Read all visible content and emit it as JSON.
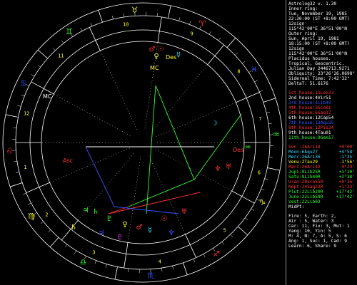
{
  "app": {
    "title": "Astrolog32 v. 1.30"
  },
  "chart_info": [
    "Inner ring:",
    "Tue, November 19, 1985",
    "22:30:00 (ST +8:00 GMT)",
    "12sign",
    "115°42'00\"E 36°51'00\"N",
    "Outer ring:",
    "Sun, April 19, 1981",
    "18:15:00 (ST +8:00 GMT)",
    "12sign",
    "115°42'00\"E 36°51'00\"N",
    "Placidus houses.",
    "Tropical, Geocentric.",
    "Julian Day 2446713.9271",
    "Obliquity: 23°26'26.0698\"",
    "Sidereal Time: 7:42'32\"",
    "DeltaT: 51.6176"
  ],
  "houses": [
    {
      "label": "1st house:",
      "value": "11Leo33",
      "color": "#ff3333"
    },
    {
      "label": "2nd house:",
      "value": "4Vir51",
      "color": "#ffffff"
    },
    {
      "label": "3rd house:",
      "value": "1Lib49",
      "color": "#3355ff"
    },
    {
      "label": "4th house:",
      "value": "3Sco01",
      "color": "#ff3333"
    },
    {
      "label": "5th house:",
      "value": "6Sag17",
      "color": "#ff3333"
    },
    {
      "label": "6th house:",
      "value": "12Cap54",
      "color": "#ffffff"
    },
    {
      "label": "7th house:",
      "value": "13Aqu35",
      "color": "#3355ff"
    },
    {
      "label": "8th house:",
      "value": "12Pis24",
      "color": "#ff3333"
    },
    {
      "label": "9th house:",
      "value": "4Tau01",
      "color": "#ffffff"
    },
    {
      "label": "11th house:",
      "value": "9Gem17",
      "color": "#33ff33"
    }
  ],
  "planets": [
    {
      "label": "Sun :",
      "value": "26Ari18",
      "extra": "+0°00'",
      "color": "#ff3333"
    },
    {
      "label": "Moon:",
      "value": "6Aqu27",
      "extra": "+4°58'",
      "color": "#33ddff"
    },
    {
      "label": "Merc:",
      "value": "26Ari36",
      "extra": "-1°35'",
      "color": "#33ddff"
    },
    {
      "label": "Venu:",
      "value": "2Tau29",
      "extra": "-1°56'",
      "color": "#ffff33"
    },
    {
      "label": "Mars:",
      "value": "26Ari42",
      "extra": "-0°29'",
      "color": "#ff3333"
    },
    {
      "label": "Jupi:",
      "value": "9Lib25R",
      "extra": "+1°10'",
      "color": "#33ff33"
    },
    {
      "label": "Satu:",
      "value": "9Lib40R",
      "extra": "+2°38'",
      "color": "#33ff33"
    },
    {
      "label": "Uran:",
      "value": "28Sco55R",
      "extra": "+0°36'",
      "color": "#ff3333"
    },
    {
      "label": "Nept:",
      "value": "24Sag23R",
      "extra": "+1°23'",
      "color": "#ff3333"
    },
    {
      "label": "Plut:",
      "value": "22Lib20R",
      "extra": "+17°42'",
      "color": "#33ff33"
    },
    {
      "label": "Juno:",
      "value": "22Lib58R",
      "extra": "+17°42'",
      "color": "#33ff33"
    },
    {
      "label": "Vest:",
      "value": "22Lib03",
      "extra": "",
      "color": "#33ff33"
    },
    {
      "label": "MidPt:",
      "value": "",
      "extra": "",
      "color": "#ffffff"
    }
  ],
  "summary": [
    "Fire: 5, Earth: 2,",
    "Air : 5, Water: 3",
    "Car: 11, Fix: 3, Mut: 1",
    "Yang: 10, Yin: 5",
    "M: 4, N: 7, A: 5, S: 6",
    "Ang: 1, Suc: 1, Cad: 9",
    "Learn: 6, Share: 9"
  ],
  "wheel": {
    "sign_glyphs": [
      "♈",
      "♉",
      "♊",
      "♋",
      "♌",
      "♍",
      "♎",
      "♏",
      "♐",
      "♑",
      "♒",
      "♓"
    ],
    "house_numbers": [
      "1",
      "2",
      "3",
      "4",
      "5",
      "6",
      "7",
      "8",
      "9",
      "10",
      "11",
      "12"
    ],
    "asc_label": "Asc",
    "mc_label": "MC",
    "des_label": "Des",
    "ic_label": "IC",
    "colors": {
      "fire": "#ff3333",
      "earth": "#ffff33",
      "air": "#33ff33",
      "water": "#3355ff"
    }
  }
}
